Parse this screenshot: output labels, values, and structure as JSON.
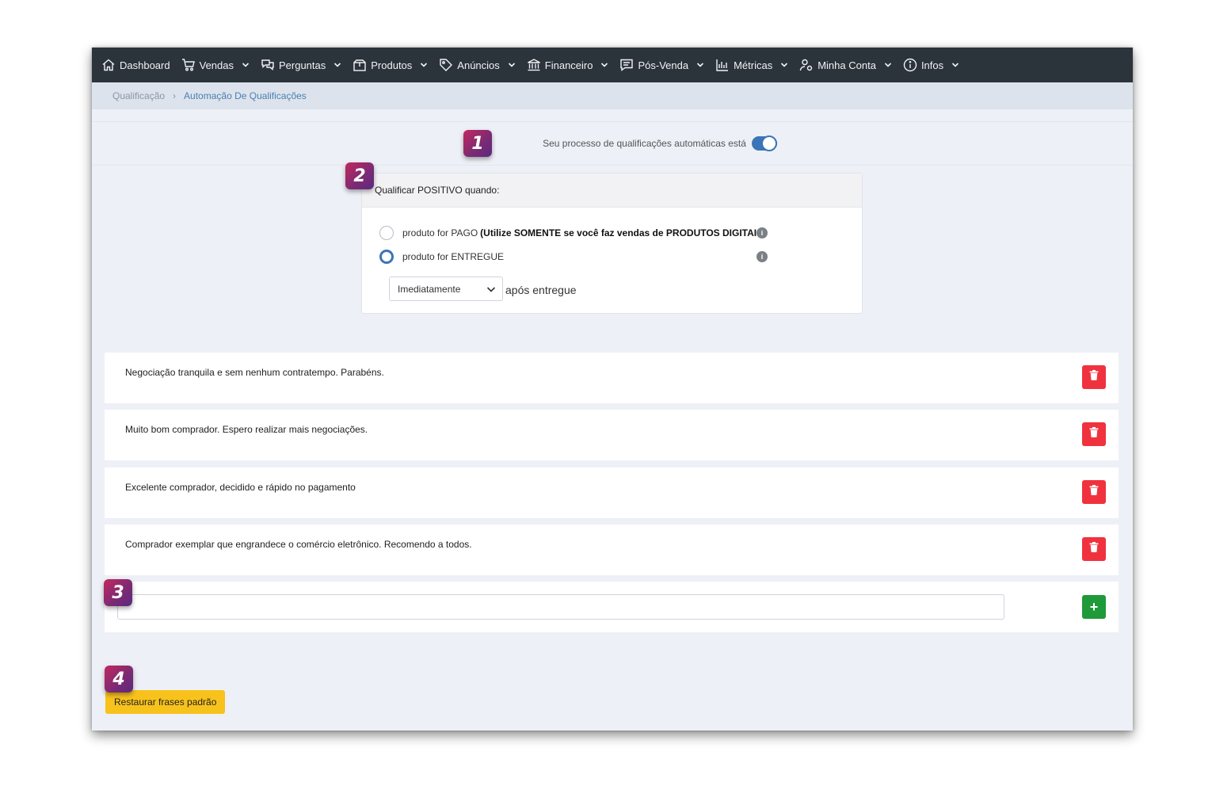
{
  "nav": {
    "items": [
      {
        "label": "Dashboard",
        "icon": "home-icon",
        "has_menu": false
      },
      {
        "label": "Vendas",
        "icon": "cart-icon",
        "has_menu": true
      },
      {
        "label": "Perguntas",
        "icon": "chat-icon",
        "has_menu": true
      },
      {
        "label": "Produtos",
        "icon": "box-icon",
        "has_menu": true
      },
      {
        "label": "Anúncios",
        "icon": "tag-icon",
        "has_menu": true
      },
      {
        "label": "Financeiro",
        "icon": "bank-icon",
        "has_menu": true
      },
      {
        "label": "Pós-Venda",
        "icon": "message-icon",
        "has_menu": true
      },
      {
        "label": "Métricas",
        "icon": "bar-chart-icon",
        "has_menu": true
      },
      {
        "label": "Minha Conta",
        "icon": "user-settings-icon",
        "has_menu": true
      },
      {
        "label": "Infos",
        "icon": "info-icon",
        "has_menu": true
      }
    ]
  },
  "breadcrumb": {
    "root": "Qualificação",
    "separator": "›",
    "current": "Automação De Qualificações"
  },
  "auto_toggle": {
    "label": "Seu processo de qualificações automáticas está",
    "enabled": true
  },
  "qualify": {
    "header": "Qualificar POSITIVO quando:",
    "option_paid": {
      "label": "produto for PAGO",
      "note": "(Utilize SOMENTE se você faz vendas de PRODUTOS DIGITAIS)",
      "selected": false
    },
    "option_delivered": {
      "label": "produto for ENTREGUE",
      "selected": true
    },
    "delay_select": "Imediatamente",
    "after_text": "após entregue"
  },
  "phrases": [
    "Negociação tranquila e sem nenhum contratempo. Parabéns.",
    "Muito bom comprador. Espero realizar mais negociações.",
    "Excelente comprador, decidido e rápido no pagamento",
    "Comprador exemplar que engrandece o comércio eletrônico. Recomendo a todos."
  ],
  "new_phrase": {
    "value": "",
    "add_label": "+"
  },
  "restore_button": "Restaurar frases padrão",
  "badges": [
    "1",
    "2",
    "3",
    "4"
  ],
  "colors": {
    "navbar": "#2b333b",
    "accent": "#3b75b8",
    "delete": "#f0323f",
    "add": "#1f9a3a",
    "restore": "#f8c21c"
  }
}
